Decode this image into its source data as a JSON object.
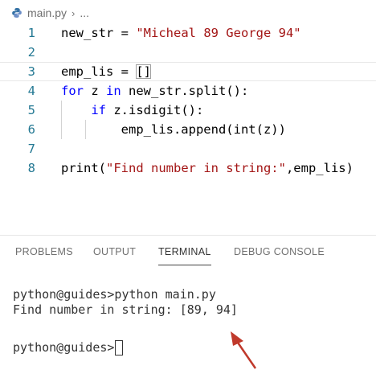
{
  "breadcrumb": {
    "file_name": "main.py",
    "separator": "›",
    "ellipsis": "..."
  },
  "editor": {
    "lines": [
      {
        "number": "1",
        "tokens": [
          {
            "t": "new_str = ",
            "c": "plain"
          },
          {
            "t": "\"Micheal 89 George 94\"",
            "c": "str"
          }
        ]
      },
      {
        "number": "2",
        "tokens": []
      },
      {
        "number": "3",
        "tokens": [
          {
            "t": "emp_lis = ",
            "c": "plain"
          },
          {
            "t": "[]",
            "c": "plain",
            "box": true
          }
        ]
      },
      {
        "number": "4",
        "tokens": [
          {
            "t": "for",
            "c": "kw"
          },
          {
            "t": " z ",
            "c": "plain"
          },
          {
            "t": "in",
            "c": "kw"
          },
          {
            "t": " new_str.split():",
            "c": "plain"
          }
        ]
      },
      {
        "number": "5",
        "tokens": [
          {
            "t": "    ",
            "c": "plain"
          },
          {
            "t": "if",
            "c": "kw"
          },
          {
            "t": " z.isdigit():",
            "c": "plain"
          }
        ]
      },
      {
        "number": "6",
        "tokens": [
          {
            "t": "        emp_lis.append(int(z))",
            "c": "plain"
          }
        ]
      },
      {
        "number": "7",
        "tokens": []
      },
      {
        "number": "8",
        "tokens": [
          {
            "t": "print(",
            "c": "plain"
          },
          {
            "t": "\"Find number in string:\"",
            "c": "str"
          },
          {
            "t": ",emp_lis)",
            "c": "plain"
          }
        ]
      }
    ]
  },
  "panel": {
    "tabs": [
      "PROBLEMS",
      "OUTPUT",
      "TERMINAL",
      "DEBUG CONSOLE"
    ],
    "active_tab": "TERMINAL"
  },
  "terminal": {
    "lines": [
      "python@guides>python main.py",
      "Find number in string: [89, 94]",
      "",
      "python@guides>"
    ]
  },
  "colors": {
    "keyword": "#0000ff",
    "string": "#a31515",
    "line_number": "#237893",
    "arrow": "#c0392b"
  },
  "icons": {
    "file_icon": "python-file-icon",
    "annotation": "red-arrow-icon"
  }
}
